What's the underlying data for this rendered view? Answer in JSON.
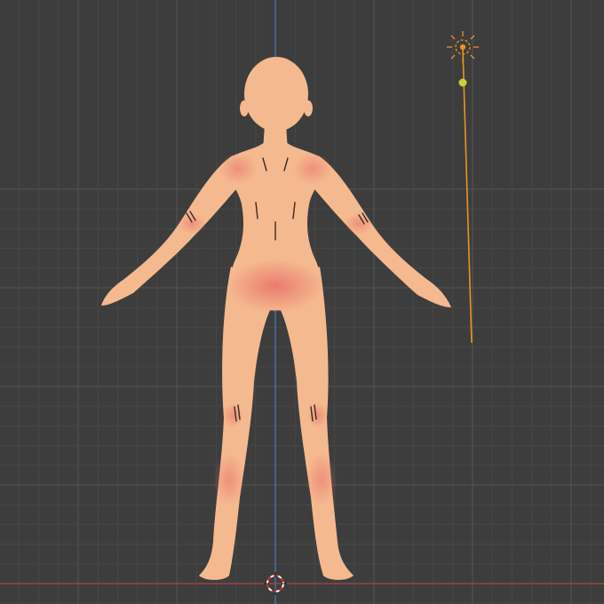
{
  "viewport": {
    "background": "#3d3d3d",
    "grid_minor_color": "#474747",
    "grid_major_color": "#555555",
    "x_axis_color": "#b04444",
    "z_axis_color": "#4a7cc0"
  },
  "character": {
    "skin_color": "#f5b98f",
    "blush_color": "#e8706a",
    "line_color": "#3a2a24"
  },
  "light": {
    "type": "sun",
    "icon": "sun-lamp-icon",
    "color": "#e8951e",
    "handle_color": "#c8d23a"
  },
  "cursor_3d": {
    "icon": "3d-cursor-icon"
  }
}
